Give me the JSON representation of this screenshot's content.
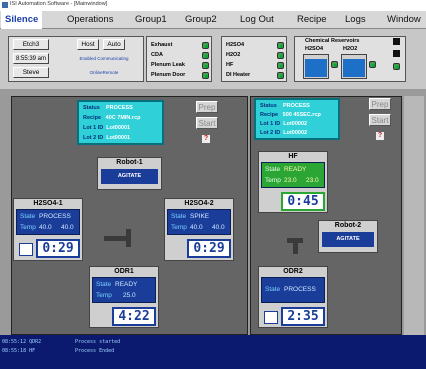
{
  "window": {
    "title": "ISI Automation Software - [Mainwindow]"
  },
  "menu": [
    {
      "label": "Silence",
      "selected": true
    },
    {
      "label": "Operations"
    },
    {
      "label": "Group1"
    },
    {
      "label": "Group2"
    },
    {
      "label": "Log Out"
    },
    {
      "label": "Recipe"
    },
    {
      "label": "Logs"
    },
    {
      "label": "Window"
    }
  ],
  "info": {
    "tool": "Etch3",
    "time": "8:55:39 am",
    "user": "Steve",
    "host_btn": "Host",
    "auto_btn": "Auto",
    "comm_status": "Enabled Communicating",
    "control_status": "OnlineRemote"
  },
  "interlocks1": [
    "Exhaust",
    "CDA",
    "Plenum Leak",
    "Plenum Door"
  ],
  "interlocks2": [
    "H2SO4",
    "H2O2",
    "HF",
    "DI Heater"
  ],
  "reservoirs": {
    "title": "Chemical Reservoirs",
    "tanks": [
      "H2SO4",
      "H2O2"
    ]
  },
  "status_left": {
    "status_label": "Status",
    "status": "PROCESS",
    "recipe_label": "Recipe",
    "recipe": "40C 7MIN.rcp",
    "lot1_label": "Lot 1 ID",
    "lot1": "Lot00001",
    "lot2_label": "Lot 2 ID",
    "lot2": "Lot00001"
  },
  "status_right": {
    "status_label": "Status",
    "status": "PROCESS",
    "recipe_label": "Recipe",
    "recipe": "500 45SEC.rcp",
    "lot1_label": "Lot 1 ID",
    "lot1": "Lot00002",
    "lot2_label": "Lot 2 ID",
    "lot2": "Lot00002"
  },
  "buttons": {
    "prep": "Prep",
    "start": "Start",
    "help": "?"
  },
  "robot1": {
    "name": "Robot-1",
    "action": "AGITATE"
  },
  "robot2": {
    "name": "Robot-2",
    "action": "AGITATE"
  },
  "tanks": {
    "h2so4_1": {
      "name": "H2SO4-1",
      "state_label": "State",
      "state": "PROCESS",
      "temp_label": "Temp",
      "temp_set": "40.0",
      "temp_act": "40.0",
      "timer": "0:29"
    },
    "h2so4_2": {
      "name": "H2SO4-2",
      "state_label": "State",
      "state": "SPIKE",
      "temp_label": "Temp",
      "temp_set": "40.0",
      "temp_act": "40.0",
      "timer": "0:29"
    },
    "odr1": {
      "name": "ODR1",
      "state_label": "State",
      "state": "READY",
      "temp_label": "Temp",
      "temp_set": "25.0",
      "timer": "4:22"
    },
    "hf": {
      "name": "HF",
      "state_label": "State",
      "state": "READY",
      "temp_label": "Temp",
      "temp_set": "23.0",
      "temp_act": "23.0",
      "timer": "0:45"
    },
    "odr2": {
      "name": "ODR2",
      "state_label": "State",
      "state": "PROCESS",
      "timer": "2:35"
    }
  },
  "log": [
    {
      "time": "08:55:12 QDR2",
      "msg": "Process started"
    },
    {
      "time": "08:55:18 HF",
      "msg": "Process Ended"
    }
  ],
  "colors": {
    "accent": "#1a3fa8",
    "status_panel": "#2fd0d8",
    "tank_blue": "#1a3d9a",
    "tank_green": "#2ba534",
    "log_bg": "#0b1a6e"
  }
}
